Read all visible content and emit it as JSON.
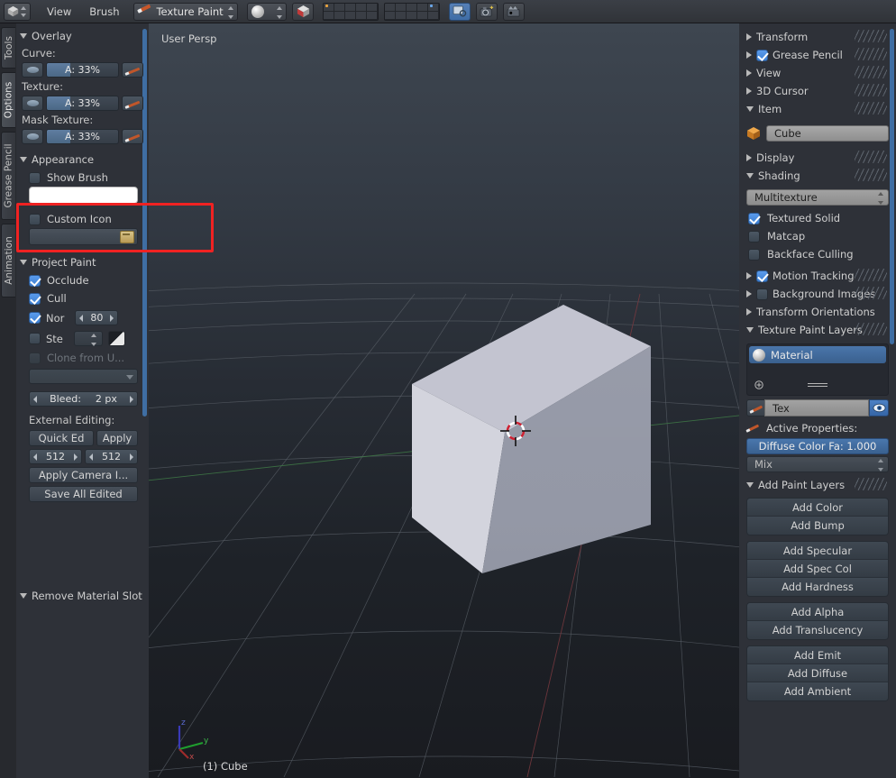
{
  "topbar": {
    "editor_type_icon": "3d-view-icon",
    "menus": [
      "View",
      "Brush"
    ],
    "mode": {
      "label": "Texture Paint",
      "icon": "texture-paint-icon"
    },
    "brush_selector_icon": "brush-sphere-icon",
    "shading_icon": "textured-shading-icon",
    "layers_label": "scene-layers",
    "render_icon": "render-window-icon",
    "camera_icon": "render-image-icon",
    "anim_icon": "render-animation-icon"
  },
  "left_tabs": [
    {
      "label": "Tools",
      "active": false
    },
    {
      "label": "Options",
      "active": true
    },
    {
      "label": "Grease Pencil",
      "active": false
    },
    {
      "label": "Animation",
      "active": false
    }
  ],
  "left_panel": {
    "overlay": {
      "title": "Overlay",
      "rows": [
        {
          "label": "Curve:",
          "alpha": "A: 33%",
          "fill_pct": 33
        },
        {
          "label": "Texture:",
          "alpha": "A: 33%",
          "fill_pct": 33
        },
        {
          "label": "Mask Texture:",
          "alpha": "A: 33%",
          "fill_pct": 33
        }
      ]
    },
    "appearance": {
      "title": "Appearance",
      "show_brush": {
        "label": "Show Brush",
        "checked": false
      },
      "color_swatch": "#ffffff",
      "custom_icon": {
        "label": "Custom Icon",
        "checked": false
      },
      "icon_path": ""
    },
    "project_paint": {
      "title": "Project Paint",
      "occlude": {
        "label": "Occlude",
        "checked": true
      },
      "cull": {
        "label": "Cull",
        "checked": true
      },
      "nor": {
        "label": "Nor",
        "checked": true,
        "value": "80"
      },
      "ste": {
        "label": "Ste",
        "checked": false,
        "value": ""
      },
      "clone_from_uv": {
        "label": "Clone from U...",
        "checked": false,
        "disabled": true
      },
      "clone_layer": "",
      "bleed": {
        "label": "Bleed:",
        "value": "2 px"
      }
    },
    "external_editing": {
      "title": "External Editing:",
      "quick_edit": "Quick Ed",
      "apply": "Apply",
      "width": "512",
      "height": "512",
      "apply_camera": "Apply Camera I...",
      "save_all": "Save All Edited"
    },
    "remove_material_slot": "Remove Material Slot"
  },
  "viewport": {
    "view_label": "User Persp",
    "object_label": "(1) Cube",
    "axis": {
      "x": "x",
      "y": "y",
      "z": "z"
    },
    "cursor": "3d-cursor"
  },
  "right_panel": {
    "sections": [
      {
        "label": "Transform",
        "open": false,
        "checkbox": null
      },
      {
        "label": "Grease Pencil",
        "open": false,
        "checkbox": true
      },
      {
        "label": "View",
        "open": false,
        "checkbox": null
      },
      {
        "label": "3D Cursor",
        "open": false,
        "checkbox": null
      },
      {
        "label": "Item",
        "open": true,
        "checkbox": null
      }
    ],
    "item": {
      "name": "Cube",
      "icon": "object-cube-icon"
    },
    "display": {
      "label": "Display",
      "open": false
    },
    "shading": {
      "label": "Shading",
      "open": true
    },
    "shading_method": "Multitexture",
    "shading_options": [
      {
        "label": "Textured Solid",
        "checked": true
      },
      {
        "label": "Matcap",
        "checked": false
      },
      {
        "label": "Backface Culling",
        "checked": false
      }
    ],
    "motion_tracking": {
      "label": "Motion Tracking",
      "checked": true,
      "open": false
    },
    "background_images": {
      "label": "Background Images",
      "checked": false,
      "open": false
    },
    "transform_orientations": {
      "label": "Transform Orientations",
      "open": false
    },
    "texture_paint_layers": {
      "label": "Texture Paint Layers",
      "open": true
    },
    "material_slot": "Material",
    "texture_slot": "Tex",
    "active_properties_label": "Active Properties:",
    "diffuse_factor": "Diffuse Color Fa: 1.000",
    "blend_mode": "Mix",
    "add_paint_layers": {
      "title": "Add Paint Layers",
      "groups": [
        [
          "Add Color",
          "Add Bump"
        ],
        [
          "Add Specular",
          "Add Spec Col",
          "Add Hardness"
        ],
        [
          "Add Alpha",
          "Add Translucency"
        ],
        [
          "Add Emit",
          "Add Diffuse",
          "Add Ambient"
        ]
      ]
    }
  },
  "annotation": {
    "highlight_color": "#f02222",
    "target": "show-brush-color-swatch"
  }
}
